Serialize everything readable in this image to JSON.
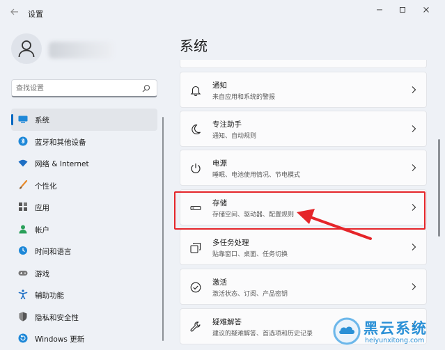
{
  "window": {
    "title": "设置",
    "back_icon": "back-arrow-icon",
    "min_icon": "minimize-icon",
    "max_icon": "maximize-icon",
    "close_icon": "close-icon"
  },
  "sidebar": {
    "search_placeholder": "查找设置",
    "items": [
      {
        "label": "系统",
        "icon": "system-display-icon",
        "active": true
      },
      {
        "label": "蓝牙和其他设备",
        "icon": "bluetooth-icon"
      },
      {
        "label": "网络 & Internet",
        "icon": "wifi-icon"
      },
      {
        "label": "个性化",
        "icon": "brush-icon"
      },
      {
        "label": "应用",
        "icon": "apps-icon"
      },
      {
        "label": "帐户",
        "icon": "account-icon"
      },
      {
        "label": "时间和语言",
        "icon": "clock-globe-icon"
      },
      {
        "label": "游戏",
        "icon": "gamepad-icon"
      },
      {
        "label": "辅助功能",
        "icon": "accessibility-icon"
      },
      {
        "label": "隐私和安全性",
        "icon": "shield-icon"
      },
      {
        "label": "Windows 更新",
        "icon": "update-icon"
      }
    ]
  },
  "main": {
    "title": "系统",
    "cards": [
      {
        "title": "通知",
        "desc": "来自应用和系统的警报",
        "icon": "bell-icon"
      },
      {
        "title": "专注助手",
        "desc": "通知、自动规则",
        "icon": "moon-icon"
      },
      {
        "title": "电源",
        "desc": "睡眠、电池使用情况、节电模式",
        "icon": "power-icon"
      },
      {
        "title": "存储",
        "desc": "存储空间、驱动器、配置规则",
        "icon": "storage-drive-icon"
      },
      {
        "title": "多任务处理",
        "desc": "贴靠窗口、桌面、任务切换",
        "icon": "multitask-icon"
      },
      {
        "title": "激活",
        "desc": "激活状态、订阅、产品密钥",
        "icon": "check-circle-icon"
      },
      {
        "title": "疑难解答",
        "desc": "建议的疑难解答、首选项和历史记录",
        "icon": "wrench-icon"
      }
    ]
  },
  "watermark": {
    "title": "黑云系统",
    "url": "heiyunxitong.com"
  },
  "colors": {
    "accent": "#0067c0",
    "highlight": "#e5252a",
    "watermark": "#2a90d6"
  }
}
